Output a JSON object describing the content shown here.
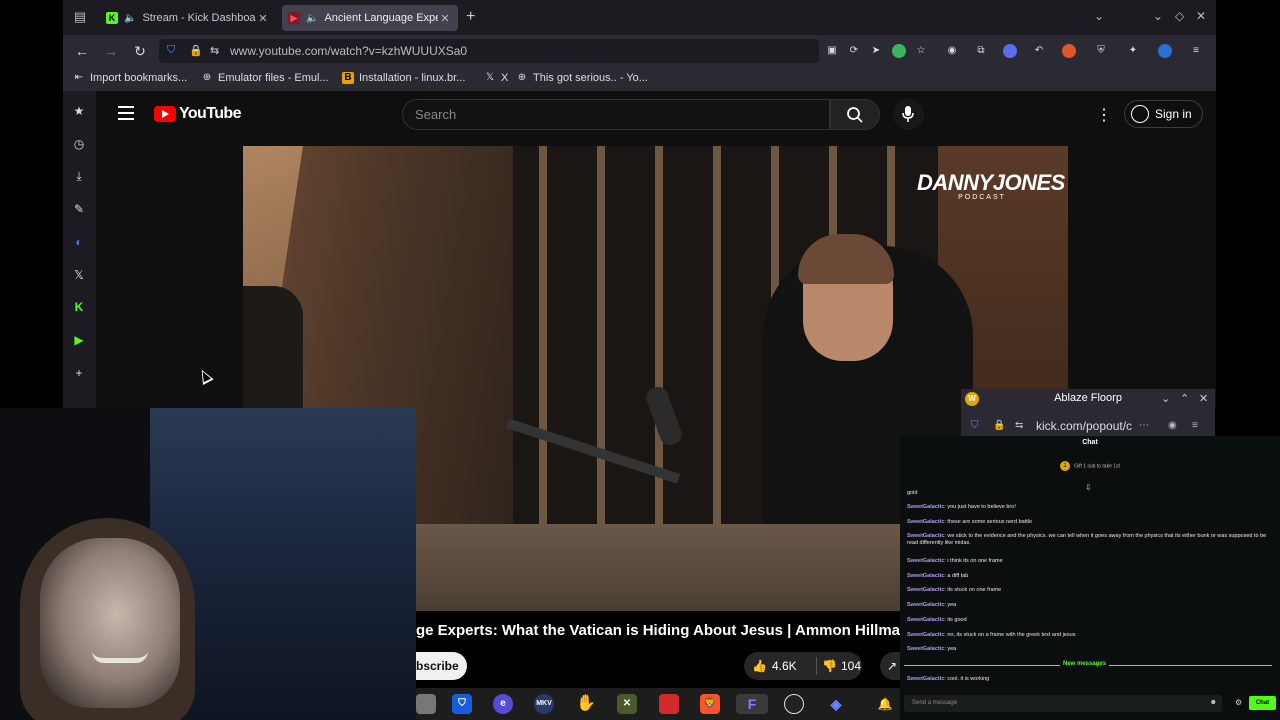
{
  "tabs": [
    {
      "label": "Stream - Kick Dashboard",
      "favicon": "K",
      "favicon_color": "#53fc18",
      "active": false,
      "audio": true
    },
    {
      "label": "Ancient Language Experts",
      "favicon": "▶",
      "favicon_color": "#ff0000",
      "active": true,
      "audio": true
    }
  ],
  "address": {
    "url": "www.youtube.com/watch?v=kzhWUUUXSa0"
  },
  "bookmarks": [
    {
      "label": "Import bookmarks...",
      "icon": "import-icon"
    },
    {
      "label": "Emulator files - Emul...",
      "icon": "globe-icon"
    },
    {
      "label": "Installation - linux.br...",
      "icon": "b-icon"
    },
    {
      "label": "X",
      "icon": "x-icon"
    },
    {
      "label": "This got serious.. - Yo...",
      "icon": "globe-icon"
    }
  ],
  "youtube": {
    "logo_text": "YouTube",
    "search_placeholder": "Search",
    "signin_label": "Sign in",
    "video_brand": "DANNYJONES",
    "video_brand_sub": "PODCAST",
    "video_title": "ge Experts: What the Vatican is Hiding About Jesus | Ammon Hillman",
    "subscribe_label": "bscribe",
    "likes": "4.6K",
    "dislikes": "104"
  },
  "popout": {
    "title": "Ablaze Floorp",
    "url": "kick.com/popout/c"
  },
  "chat": {
    "header": "Chat",
    "pinned_sub": "Gift 1 sub to take 1st",
    "messages": [
      {
        "user": "",
        "text": "gold"
      },
      {
        "user": "SweetGalactic",
        "text": "you just have to believe bro!"
      },
      {
        "user": "SweetGalactic",
        "text": "these are some serious nerd battle"
      },
      {
        "user": "SweetGalactic",
        "text": "we stick to the evidence and the physics. we can tell when it goes away from the physics that its either bunk or was supposed to be read differently like midas."
      },
      {
        "user": "SweetGalactic",
        "text": "i think its on one frame"
      },
      {
        "user": "SweetGalactic",
        "text": "a diff tab"
      },
      {
        "user": "SweetGalactic",
        "text": "its stuck on one frame"
      },
      {
        "user": "SweetGalactic",
        "text": "yea"
      },
      {
        "user": "SweetGalactic",
        "text": "its good"
      },
      {
        "user": "SweetGalactic",
        "text": "no, its stuck on a frame with the greek text and jesus"
      },
      {
        "user": "SweetGalactic",
        "text": "yea"
      },
      {
        "user": "SweetGalactic",
        "text": "cool. it is working"
      }
    ],
    "new_messages_label": "New messages",
    "input_placeholder": "Send a message",
    "send_label": "Chat"
  },
  "colors": {
    "kick_green": "#53fc18",
    "youtube_red": "#ff0000",
    "chat_username": "#b39cf0"
  }
}
